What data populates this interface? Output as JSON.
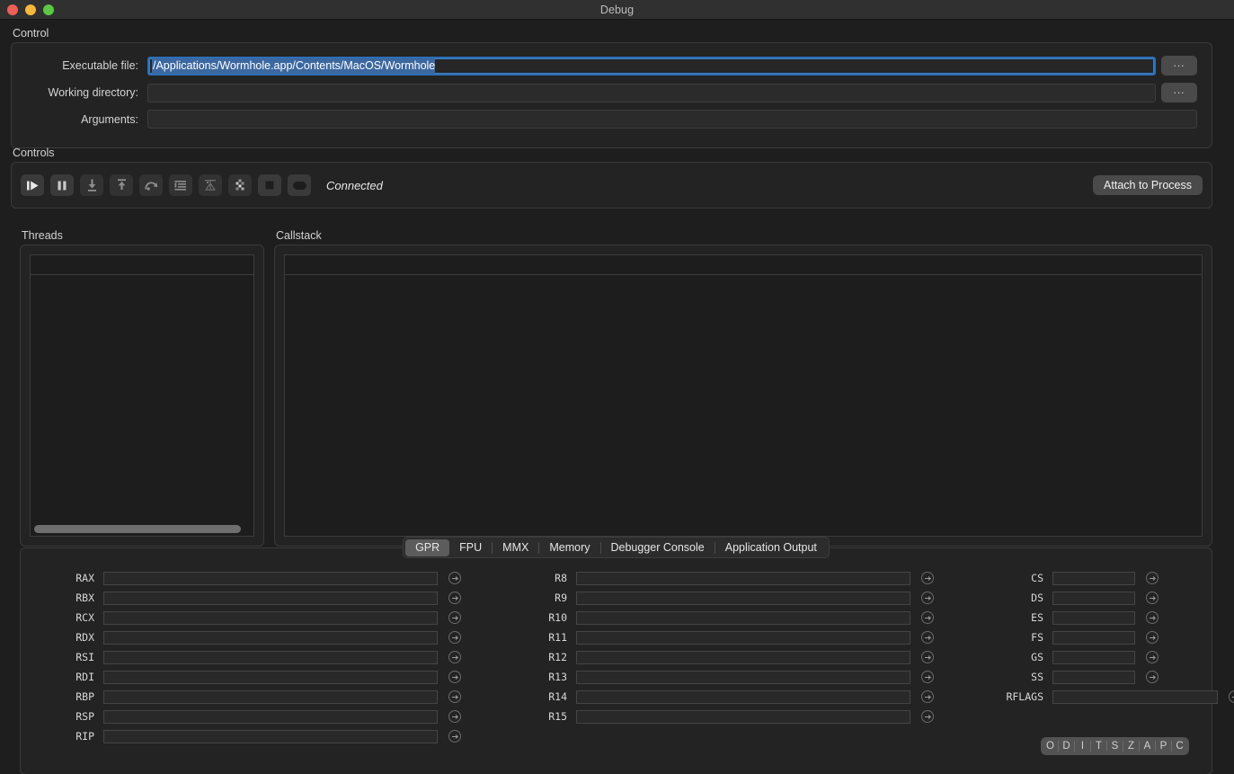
{
  "window": {
    "title": "Debug",
    "traffic_lights": [
      "close",
      "minimize",
      "zoom"
    ]
  },
  "control": {
    "group_label": "Control",
    "rows": [
      {
        "label": "Executable file:",
        "value": "/Applications/Wormhole.app/Contents/MacOS/Wormhole",
        "placeholder": "",
        "selected": true,
        "browse_label": "..."
      },
      {
        "label": "Working directory:",
        "value": "",
        "placeholder": "",
        "selected": false,
        "browse_label": "..."
      },
      {
        "label": "Arguments:",
        "value": "",
        "placeholder": "",
        "selected": false,
        "browse_label": ""
      }
    ]
  },
  "controls": {
    "group_label": "Controls",
    "status": "Connected",
    "attach_label": "Attach to Process",
    "buttons": [
      {
        "name": "continue-icon",
        "title": "Continue",
        "enabled": true
      },
      {
        "name": "pause-icon",
        "title": "Pause",
        "enabled": true
      },
      {
        "name": "step-into-icon",
        "title": "Step Into",
        "enabled": false
      },
      {
        "name": "step-out-icon",
        "title": "Step Out",
        "enabled": false
      },
      {
        "name": "step-over-icon",
        "title": "Step Over",
        "enabled": false
      },
      {
        "name": "disassembly-icon",
        "title": "Disassembly",
        "enabled": false
      },
      {
        "name": "breakpoints-icon",
        "title": "Breakpoints",
        "enabled": false
      },
      {
        "name": "registers-icon",
        "title": "Registers",
        "enabled": false
      },
      {
        "name": "stop-icon",
        "title": "Stop",
        "enabled": true
      },
      {
        "name": "detach-icon",
        "title": "Detach",
        "enabled": true
      }
    ]
  },
  "threads": {
    "group_label": "Threads",
    "rows": [],
    "has_hscrollbar": true
  },
  "callstack": {
    "group_label": "Callstack",
    "rows": []
  },
  "tabs": {
    "items": [
      "GPR",
      "FPU",
      "MMX",
      "Memory",
      "Debugger Console",
      "Application Output"
    ],
    "active": "GPR"
  },
  "registers": {
    "column_a": [
      {
        "label": "RAX",
        "value": ""
      },
      {
        "label": "RBX",
        "value": ""
      },
      {
        "label": "RCX",
        "value": ""
      },
      {
        "label": "RDX",
        "value": ""
      },
      {
        "label": "RSI",
        "value": ""
      },
      {
        "label": "RDI",
        "value": ""
      },
      {
        "label": "RBP",
        "value": ""
      },
      {
        "label": "RSP",
        "value": ""
      },
      {
        "label": "RIP",
        "value": ""
      }
    ],
    "column_b": [
      {
        "label": "R8",
        "value": ""
      },
      {
        "label": "R9",
        "value": ""
      },
      {
        "label": "R10",
        "value": ""
      },
      {
        "label": "R11",
        "value": ""
      },
      {
        "label": "R12",
        "value": ""
      },
      {
        "label": "R13",
        "value": ""
      },
      {
        "label": "R14",
        "value": ""
      },
      {
        "label": "R15",
        "value": ""
      }
    ],
    "column_c": [
      {
        "label": "CS",
        "value": "",
        "wide": false
      },
      {
        "label": "DS",
        "value": "",
        "wide": false
      },
      {
        "label": "ES",
        "value": "",
        "wide": false
      },
      {
        "label": "FS",
        "value": "",
        "wide": false
      },
      {
        "label": "GS",
        "value": "",
        "wide": false
      },
      {
        "label": "SS",
        "value": "",
        "wide": false
      },
      {
        "label": "RFLAGS",
        "value": "",
        "wide": true
      }
    ]
  },
  "flags": [
    "O",
    "D",
    "I",
    "T",
    "S",
    "Z",
    "A",
    "P",
    "C"
  ],
  "colors": {
    "window_bg": "#1e1e1e",
    "panel_bg": "#232323",
    "field_bg": "#2b2b2b",
    "border": "#3a3a3a",
    "accent_focus": "#2e6fb7",
    "selection": "#3c68a0",
    "button_bg": "#4a4a4a",
    "text": "#e3e3e3"
  }
}
